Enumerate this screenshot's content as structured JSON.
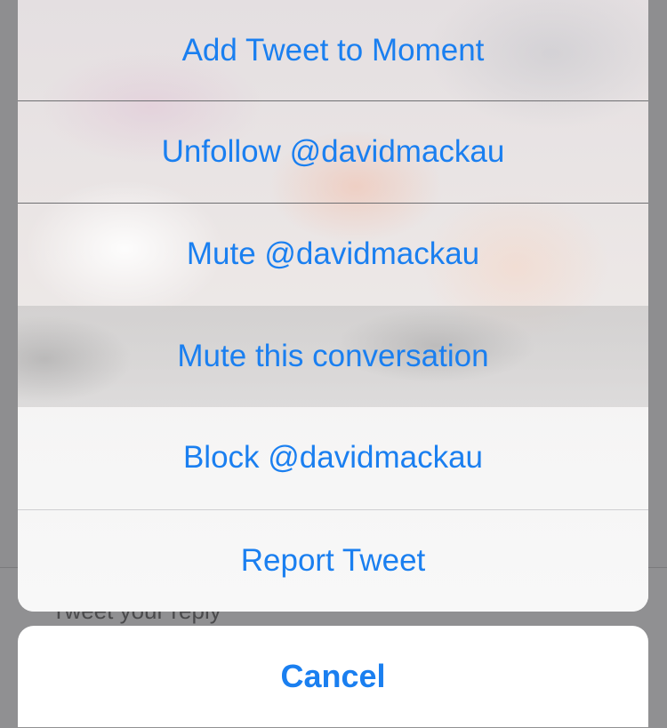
{
  "background": {
    "reply_placeholder": "Tweet your reply"
  },
  "action_sheet": {
    "items": [
      {
        "label": "Add Tweet to Moment"
      },
      {
        "label": "Unfollow @davidmackau"
      },
      {
        "label": "Mute @davidmackau"
      },
      {
        "label": "Mute this conversation"
      },
      {
        "label": "Block @davidmackau"
      },
      {
        "label": "Report Tweet"
      }
    ],
    "cancel_label": "Cancel"
  },
  "colors": {
    "action_blue": "#1a7ff0",
    "dim_overlay": "#8e8e90",
    "cancel_bg": "#ffffff"
  }
}
